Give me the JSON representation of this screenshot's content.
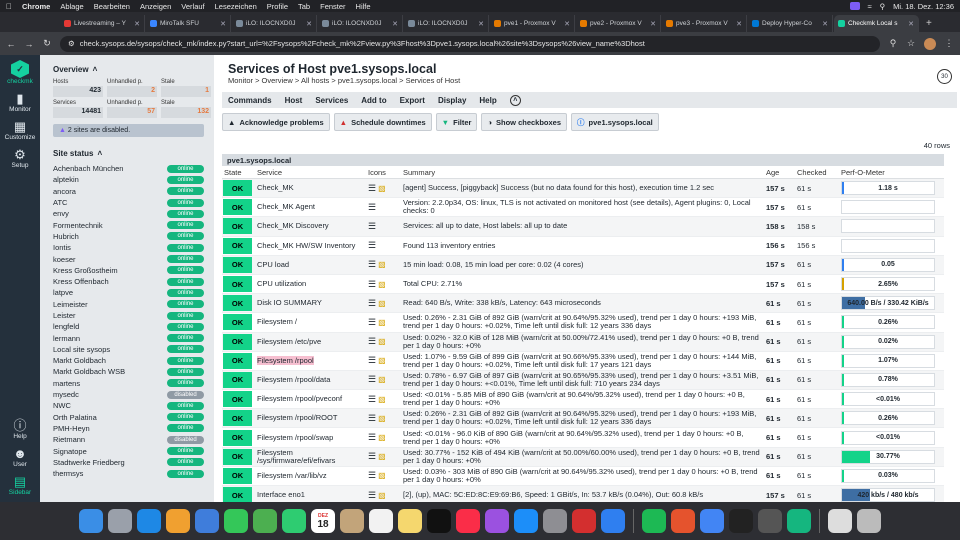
{
  "menubar": {
    "apple": "",
    "app": "Chrome",
    "menus": [
      "Ablage",
      "Bearbeiten",
      "Anzeigen",
      "Verlauf",
      "Lesezeichen",
      "Profile",
      "Tab",
      "Fenster",
      "Hilfe"
    ],
    "clock": "Mi. 18. Dez.  12:36"
  },
  "tabs": [
    {
      "title": "Livestreaming – Y"
    },
    {
      "title": "MiroTalk SFU"
    },
    {
      "title": "iLO: ILOCNXD0J"
    },
    {
      "title": "iLO: ILOCNXD0J"
    },
    {
      "title": "iLO: ILOCNXD0J"
    },
    {
      "title": "pve1 - Proxmox V"
    },
    {
      "title": "pve2 - Proxmox V"
    },
    {
      "title": "pve3 - Proxmox V"
    },
    {
      "title": "Deploy Hyper-Co"
    },
    {
      "title": "Checkmk Local s"
    }
  ],
  "address": {
    "url": "check.sysops.de/sysops/check_mk/index.py?start_url=%2Fsysops%2Fcheck_mk%2Fview.py%3Fhost%3Dpve1.sysops.local%26site%3Dsysops%26view_name%3Dhost"
  },
  "leftnav": {
    "logo": "checkmk",
    "monitor": "Monitor",
    "customize": "Customize",
    "setup": "Setup",
    "help": "Help",
    "user": "User",
    "sidebar": "Sidebar"
  },
  "sidebar": {
    "overview_title": "Overview",
    "hosts_label": "Hosts",
    "hosts_val": "423",
    "hosts_unh_label": "Unhandled p.",
    "hosts_unh_val": "2",
    "hosts_stale_label": "Stale",
    "hosts_stale_val": "1",
    "svc_label": "Services",
    "svc_val": "14481",
    "svc_unh_label": "Unhandled p.",
    "svc_unh_val": "57",
    "svc_stale_label": "Stale",
    "svc_stale_val": "132",
    "disabled_note": "2 sites are disabled.",
    "site_status_title": "Site status",
    "sites": [
      {
        "name": "Achenbach München",
        "status": "online"
      },
      {
        "name": "alptekin",
        "status": "online"
      },
      {
        "name": "ancora",
        "status": "online"
      },
      {
        "name": "ATC",
        "status": "online"
      },
      {
        "name": "envy",
        "status": "online"
      },
      {
        "name": "Formentechnik",
        "status": "online"
      },
      {
        "name": "Hubrich",
        "status": "online"
      },
      {
        "name": "Iontis",
        "status": "online"
      },
      {
        "name": "koeser",
        "status": "online"
      },
      {
        "name": "Kress Großostheim",
        "status": "online"
      },
      {
        "name": "Kress Offenbach",
        "status": "online"
      },
      {
        "name": "latpve",
        "status": "online"
      },
      {
        "name": "Leimeister",
        "status": "online"
      },
      {
        "name": "Leister",
        "status": "online"
      },
      {
        "name": "lengfeld",
        "status": "online"
      },
      {
        "name": "lermann",
        "status": "online"
      },
      {
        "name": "Local site sysops",
        "status": "online"
      },
      {
        "name": "Markt Goldbach",
        "status": "online"
      },
      {
        "name": "Markt Goldbach WSB",
        "status": "online"
      },
      {
        "name": "martens",
        "status": "online"
      },
      {
        "name": "mysedc",
        "status": "disabled"
      },
      {
        "name": "NWC",
        "status": "online"
      },
      {
        "name": "Orth Palatina",
        "status": "online"
      },
      {
        "name": "PMH-Heyn",
        "status": "online"
      },
      {
        "name": "Rietmann",
        "status": "disabled"
      },
      {
        "name": "Signatope",
        "status": "online"
      },
      {
        "name": "Stadtwerke Friedberg",
        "status": "online"
      },
      {
        "name": "thermsys",
        "status": "online"
      }
    ]
  },
  "main": {
    "title": "Services of Host pve1.sysops.local",
    "breadcrumb": "Monitor > Overview > All hosts > pve1.sysops.local > Services of Host",
    "refresh": "30",
    "menu": [
      "Commands",
      "Host",
      "Services",
      "Add to",
      "Export",
      "Display",
      "Help"
    ],
    "buttons": {
      "ack": "Acknowledge problems",
      "downtime": "Schedule downtimes",
      "filter": "Filter",
      "checkboxes": "Show checkboxes",
      "host": "pve1.sysops.local"
    },
    "rows_count": "40 rows",
    "table_host": "pve1.sysops.local",
    "columns": {
      "state": "State",
      "service": "Service",
      "icons": "Icons",
      "summary": "Summary",
      "age": "Age",
      "checked": "Checked",
      "perf": "Perf-O-Meter"
    },
    "services": [
      {
        "state": "OK",
        "service": "Check_MK",
        "folder": true,
        "summary": "[agent] Success, [piggyback] Success (but no data found for this host), execution time 1.2 sec",
        "age": "157 s",
        "checked": "61 s",
        "perf": "1.18 s",
        "perf_fill": 0.012,
        "perf_color": "#2f7ff0"
      },
      {
        "state": "OK",
        "service": "Check_MK Agent",
        "folder": false,
        "summary": "Version: 2.2.0p34, OS: linux, TLS is not activated on monitored host (see details), Agent plugins: 0, Local checks: 0",
        "age": "157 s",
        "checked": "61 s",
        "perf": "",
        "perf_fill": 0,
        "perf_color": "#fff"
      },
      {
        "state": "OK",
        "service": "Check_MK Discovery",
        "folder": false,
        "summary": "Services: all up to date, Host labels: all up to date",
        "age": "158 s",
        "checked": "158 s",
        "perf": "",
        "perf_fill": 0,
        "perf_color": "#fff"
      },
      {
        "state": "OK",
        "service": "Check_MK HW/SW Inventory",
        "folder": false,
        "summary": "Found 113 inventory entries",
        "age": "156 s",
        "checked": "156 s",
        "perf": "",
        "perf_fill": 0,
        "perf_color": "#fff"
      },
      {
        "state": "OK",
        "service": "CPU load",
        "folder": true,
        "summary": "15 min load: 0.08, 15 min load per core: 0.02 (4 cores)",
        "age": "157 s",
        "checked": "61 s",
        "perf": "0.05",
        "perf_fill": 0.02,
        "perf_color": "#2f7ff0"
      },
      {
        "state": "OK",
        "service": "CPU utilization",
        "folder": true,
        "summary": "Total CPU: 2.71%",
        "age": "157 s",
        "checked": "61 s",
        "perf": "2.65%",
        "perf_fill": 0.0265,
        "perf_color": "#d5a100"
      },
      {
        "state": "OK",
        "service": "Disk IO SUMMARY",
        "folder": true,
        "summary": "Read: 640 B/s, Write: 338 kB/s, Latency: 643 microseconds",
        "age": "61 s",
        "checked": "61 s",
        "perf": "640.00 B/s / 330.42 KiB/s",
        "perf_fill": 0.25,
        "perf_color": "#3e6ea3"
      },
      {
        "state": "OK",
        "service": "Filesystem /",
        "folder": true,
        "summary": "Used: 0.26% - 2.31 GiB of 892 GiB (warn/crit at 90.64%/95.32% used), trend per 1 day 0 hours: +193 MiB, trend per 1 day 0 hours: +0.02%, Time left until disk full: 12 years 336 days",
        "age": "61 s",
        "checked": "61 s",
        "perf": "0.26%",
        "perf_fill": 0.0026,
        "perf_color": "#13d389"
      },
      {
        "state": "OK",
        "service": "Filesystem /etc/pve",
        "folder": true,
        "summary": "Used: 0.02% - 32.0 KiB of 128 MiB (warn/crit at 50.00%/72.41% used), trend per 1 day 0 hours: +0 B, trend per 1 day 0 hours: +0%",
        "age": "61 s",
        "checked": "61 s",
        "perf": "0.02%",
        "perf_fill": 0.0002,
        "perf_color": "#13d389"
      },
      {
        "state": "OK",
        "service": "Filesystem /rpool",
        "folder": true,
        "highlight": true,
        "summary": "Used: 1.07% - 9.59 GiB of 899 GiB (warn/crit at 90.66%/95.33% used), trend per 1 day 0 hours: +144 MiB, trend per 1 day 0 hours: +0.02%, Time left until disk full: 17 years 121 days",
        "age": "61 s",
        "checked": "61 s",
        "perf": "1.07%",
        "perf_fill": 0.0107,
        "perf_color": "#13d389"
      },
      {
        "state": "OK",
        "service": "Filesystem /rpool/data",
        "folder": true,
        "summary": "Used: 0.78% - 6.97 GiB of 897 GiB (warn/crit at 90.65%/95.33% used), trend per 1 day 0 hours: +3.51 MiB, trend per 1 day 0 hours: +<0.01%, Time left until disk full: 710 years 234 days",
        "age": "61 s",
        "checked": "61 s",
        "perf": "0.78%",
        "perf_fill": 0.0078,
        "perf_color": "#13d389"
      },
      {
        "state": "OK",
        "service": "Filesystem /rpool/pveconf",
        "folder": true,
        "summary": "Used: <0.01% - 5.85 MiB of 890 GiB (warn/crit at 90.64%/95.32% used), trend per 1 day 0 hours: +0 B, trend per 1 day 0 hours: +0%",
        "age": "61 s",
        "checked": "61 s",
        "perf": "<0.01%",
        "perf_fill": 0.0001,
        "perf_color": "#13d389"
      },
      {
        "state": "OK",
        "service": "Filesystem /rpool/ROOT",
        "folder": true,
        "summary": "Used: 0.26% - 2.31 GiB of 892 GiB (warn/crit at 90.64%/95.32% used), trend per 1 day 0 hours: +193 MiB, trend per 1 day 0 hours: +0.02%, Time left until disk full: 12 years 336 days",
        "age": "61 s",
        "checked": "61 s",
        "perf": "0.26%",
        "perf_fill": 0.0026,
        "perf_color": "#13d389"
      },
      {
        "state": "OK",
        "service": "Filesystem /rpool/swap",
        "folder": true,
        "summary": "Used: <0.01% - 96.0 KiB of 890 GiB (warn/crit at 90.64%/95.32% used), trend per 1 day 0 hours: +0 B, trend per 1 day 0 hours: +0%",
        "age": "61 s",
        "checked": "61 s",
        "perf": "<0.01%",
        "perf_fill": 0.0001,
        "perf_color": "#13d389"
      },
      {
        "state": "OK",
        "service": "Filesystem /sys/firmware/efi/efivars",
        "folder": true,
        "summary": "Used: 30.77% - 152 KiB of 494 KiB (warn/crit at 50.00%/60.00% used), trend per 1 day 0 hours: +0 B, trend per 1 day 0 hours: +0%",
        "age": "61 s",
        "checked": "61 s",
        "perf": "30.77%",
        "perf_fill": 0.3077,
        "perf_color": "#13d389"
      },
      {
        "state": "OK",
        "service": "Filesystem /var/lib/vz",
        "folder": true,
        "summary": "Used: 0.03% - 303 MiB of 890 GiB (warn/crit at 90.64%/95.32% used), trend per 1 day 0 hours: +0 B, trend per 1 day 0 hours: +0%",
        "age": "61 s",
        "checked": "61 s",
        "perf": "0.03%",
        "perf_fill": 0.0003,
        "perf_color": "#13d389"
      },
      {
        "state": "OK",
        "service": "Interface eno1",
        "folder": true,
        "summary": "[2], (up), MAC: 5C:ED:8C:E9:69:B6, Speed: 1 GBit/s, In: 53.7 kB/s (0.04%), Out: 60.8 kB/s",
        "age": "157 s",
        "checked": "61 s",
        "perf": "420 kb/s / 480 kb/s",
        "perf_fill": 0.3,
        "perf_color": "#3e6ea3"
      }
    ]
  },
  "dock": {
    "apps": [
      "finder-icon",
      "launchpad-icon",
      "safari-icon",
      "photos-icon",
      "mail-icon",
      "messages-icon",
      "maps-icon",
      "facetime-icon",
      "calendar-icon",
      "contacts-icon",
      "reminders-icon",
      "notes-icon",
      "tv-icon",
      "music-icon",
      "podcasts-icon",
      "appstore-icon",
      "settings-icon",
      "app-red-icon",
      "app-globe-icon",
      "spotify-icon",
      "app-orange-icon",
      "chrome-icon",
      "terminal-icon",
      "calculator-icon",
      "app-green-icon",
      "document-icon",
      "trash-icon"
    ],
    "calendar_month": "DEZ",
    "calendar_day": "18"
  }
}
